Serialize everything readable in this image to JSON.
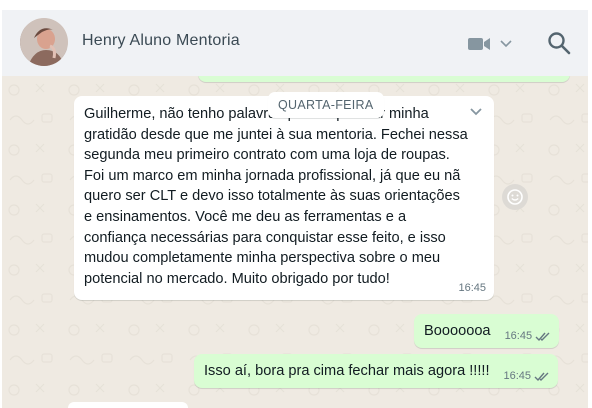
{
  "contact": {
    "name": "Henry Aluno Mentoria"
  },
  "date_separator": "QUARTA-FEIRA",
  "messages": [
    {
      "direction": "in",
      "text": "Guilherme, não tenho palavras para expressar minha\ngratidão desde que me juntei à sua mentoria. Fechei nessa\nsegunda meu primeiro contrato com uma loja de roupas.\nFoi um marco em minha jornada profissional, já que eu nã\nquero ser CLT e devo isso totalmente às suas orientações\ne ensinamentos. Você me deu as ferramentas e a\nconfiança necessárias para conquistar esse feito, e isso\nmudou completamente minha perspectiva sobre o meu\npotencial no mercado. Muito obrigado por tudo!",
      "time": "16:45"
    },
    {
      "direction": "out",
      "text": "Booooooa",
      "time": "16:45",
      "status": "read"
    },
    {
      "direction": "out",
      "text": "Isso aí, bora pra cima fechar mais agora !!!!!",
      "time": "16:45",
      "status": "read"
    }
  ],
  "icons": {
    "video": "video-camera-icon",
    "search": "search-icon",
    "emoji": "emoji-icon",
    "ticks": "double-check-icon",
    "chevron": "chevron-down-icon"
  },
  "colors": {
    "header_bg": "#f0f2f5",
    "chat_bg": "#efeae2",
    "incoming_bubble": "#ffffff",
    "outgoing_bubble": "#d9fdd3",
    "read_ticks": "#667781"
  }
}
